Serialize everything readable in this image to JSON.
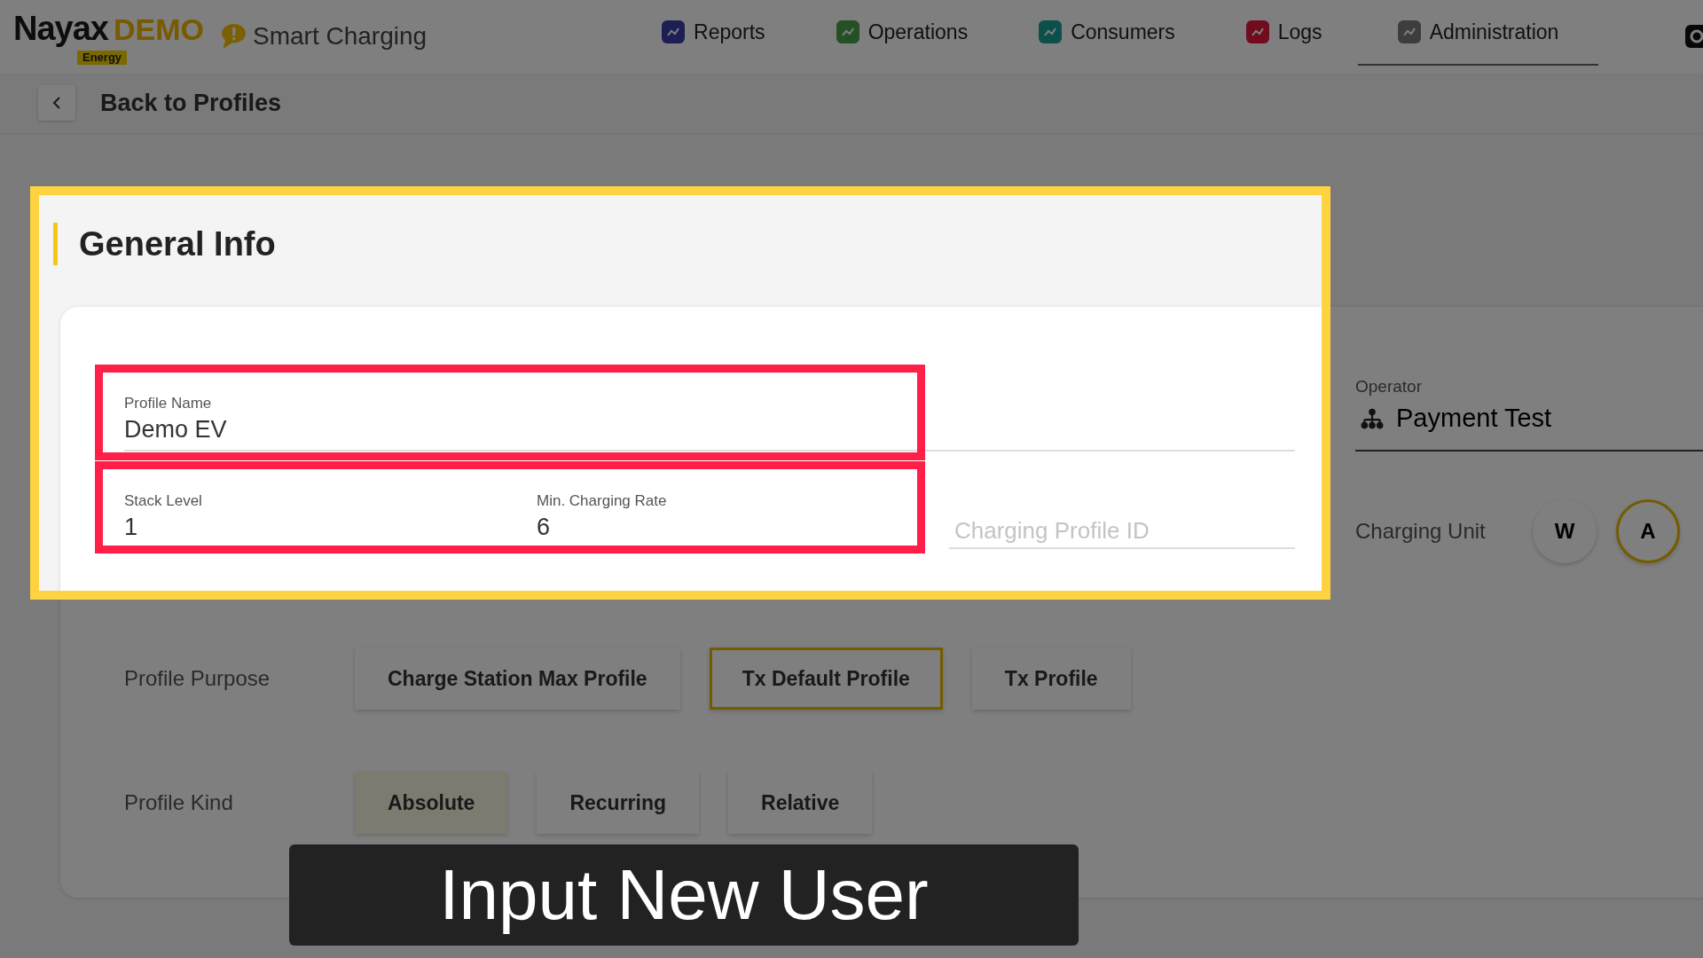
{
  "header": {
    "logo": {
      "name": "Nayax",
      "demo": "DEMO",
      "badge": "Energy"
    },
    "app_name": "Smart Charging",
    "nav": [
      {
        "label": "Reports",
        "selected": false
      },
      {
        "label": "Operations",
        "selected": false
      },
      {
        "label": "Consumers",
        "selected": false
      },
      {
        "label": "Logs",
        "selected": false
      },
      {
        "label": "Administration",
        "selected": true
      }
    ]
  },
  "back": {
    "label": "Back to Profiles"
  },
  "section": {
    "title": "General Info"
  },
  "fields": {
    "profile_name": {
      "label": "Profile Name",
      "value": "Demo EV"
    },
    "stack_level": {
      "label": "Stack Level",
      "value": "1"
    },
    "min_charging_rate": {
      "label": "Min. Charging Rate",
      "value": "6"
    },
    "charging_profile_id": {
      "placeholder": "Charging Profile ID"
    }
  },
  "operator": {
    "label": "Operator",
    "value": "Payment Test"
  },
  "charging_unit": {
    "label": "Charging Unit",
    "options": [
      {
        "label": "W",
        "selected": false
      },
      {
        "label": "A",
        "selected": true
      }
    ]
  },
  "profile_purpose": {
    "label": "Profile Purpose",
    "options": [
      {
        "label": "Charge Station Max Profile",
        "selected": false
      },
      {
        "label": "Tx Default Profile",
        "selected": true
      },
      {
        "label": "Tx Profile",
        "selected": false
      }
    ]
  },
  "profile_kind": {
    "label": "Profile Kind",
    "options": [
      {
        "label": "Absolute",
        "selected": true
      },
      {
        "label": "Recurring",
        "selected": false
      },
      {
        "label": "Relative",
        "selected": false
      }
    ]
  },
  "caption": "Input New User"
}
